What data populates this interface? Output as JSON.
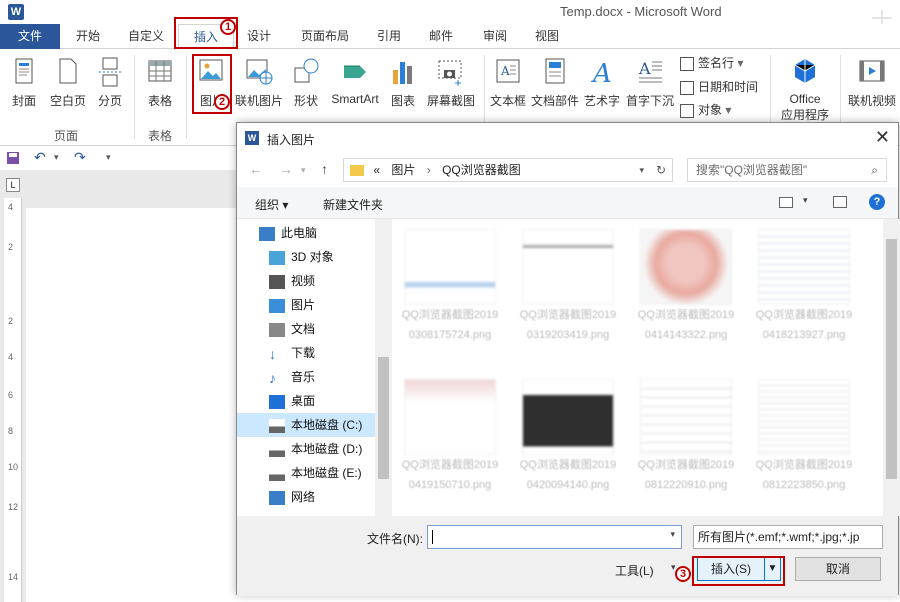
{
  "window": {
    "app_icon": "W",
    "title": "Temp.docx - Microsoft Word"
  },
  "tabs": [
    "文件",
    "开始",
    "自定义",
    "插入",
    "设计",
    "页面布局",
    "引用",
    "邮件",
    "审阅",
    "视图"
  ],
  "ribbon": {
    "pages_group": {
      "cover": "封面",
      "blank_page": "空白页",
      "page_break": "分页",
      "label": "页面"
    },
    "table_group": {
      "table": "表格",
      "label": "表格"
    },
    "illustrations": {
      "picture": "图片",
      "online_picture": "联机图片",
      "shapes": "形状",
      "smartart": "SmartArt",
      "chart": "图表",
      "screenshot": "屏幕截图"
    },
    "text_group": {
      "textbox": "文本框",
      "quick_parts": "文档部件",
      "wordart": "艺术字",
      "dropcap": "首字下沉",
      "signature_line": "签名行",
      "date_time": "日期和时间",
      "object": "对象"
    },
    "office_apps_line1": "Office",
    "office_apps_line2": "应用程序",
    "online_video": "联机视频"
  },
  "annotations": [
    "1",
    "2",
    "3"
  ],
  "ruler_marks": [
    "4",
    "2",
    "2",
    "4",
    "6",
    "8",
    "10",
    "12",
    "14"
  ],
  "dialog": {
    "title": "插入图片",
    "breadcrumb": {
      "prefix": "«",
      "part1": "图片",
      "part2": "QQ浏览器截图"
    },
    "search_placeholder": "搜索\"QQ浏览器截图\"",
    "organize": "组织 ▾",
    "new_folder": "新建文件夹",
    "nav_items": [
      "此电脑",
      "3D 对象",
      "视频",
      "图片",
      "文档",
      "下载",
      "音乐",
      "桌面",
      "本地磁盘 (C:)",
      "本地磁盘 (D:)",
      "本地磁盘 (E:)",
      "网络"
    ],
    "files": [
      {
        "name": "QQ浏览器截图20190308175724.png"
      },
      {
        "name": "QQ浏览器截图20190319203419.png"
      },
      {
        "name": "QQ浏览器截图20190414143322.png"
      },
      {
        "name": "QQ浏览器截图20190418213927.png"
      },
      {
        "name": "QQ浏览器截图20190419150710.png"
      },
      {
        "name": "QQ浏览器截图20190420094140.png"
      },
      {
        "name": "QQ浏览器截图20190812220910.png"
      },
      {
        "name": "QQ浏览器截图20190812223850.png"
      }
    ],
    "filename_label": "文件名(N):",
    "filename_value": "",
    "filetype": "所有图片(*.emf;*.wmf;*.jpg;*.jp",
    "tools": "工具(L)",
    "insert": "插入(S)",
    "cancel": "取消"
  },
  "colors": {
    "word_blue": "#2b579a",
    "highlight_red": "#c00000",
    "selection": "#cce8ff"
  }
}
